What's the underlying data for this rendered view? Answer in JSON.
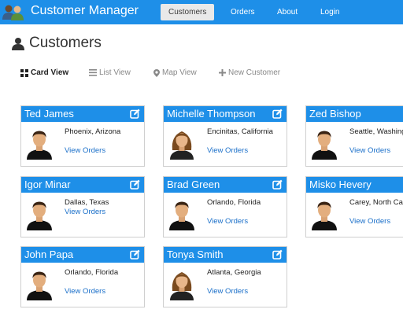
{
  "app": {
    "title": "Customer Manager",
    "accent": "#1e8fe8"
  },
  "nav": {
    "items": [
      {
        "label": "Customers",
        "active": true
      },
      {
        "label": "Orders",
        "active": false
      },
      {
        "label": "About",
        "active": false
      },
      {
        "label": "Login",
        "active": false
      }
    ]
  },
  "page": {
    "title": "Customers",
    "title_icon": "user-icon"
  },
  "toolbar": {
    "items": [
      {
        "label": "Card View",
        "icon": "grid-icon",
        "active": true
      },
      {
        "label": "List View",
        "icon": "list-icon",
        "active": false
      },
      {
        "label": "Map View",
        "icon": "map-marker-icon",
        "active": false
      },
      {
        "label": "New Customer",
        "icon": "plus-icon",
        "active": false
      }
    ]
  },
  "customers": [
    {
      "name": "Ted James",
      "city": "Phoenix, Arizona",
      "link": "View Orders",
      "avatar": "male-avatar-icon"
    },
    {
      "name": "Michelle Thompson",
      "city": "Encinitas, California",
      "link": "View Orders",
      "avatar": "female-avatar-icon"
    },
    {
      "name": "Zed Bishop",
      "city": "Seattle, Washington",
      "link": "View Orders",
      "avatar": "male-avatar-icon"
    },
    {
      "name": "Igor Minar",
      "city": "Dallas, Texas",
      "link": "View Orders",
      "avatar": "male-avatar-icon"
    },
    {
      "name": "Brad Green",
      "city": "Orlando, Florida",
      "link": "View Orders",
      "avatar": "male-avatar-icon"
    },
    {
      "name": "Misko Hevery",
      "city": "Carey, North Carolina",
      "link": "View Orders",
      "avatar": "male-avatar-icon"
    },
    {
      "name": "John Papa",
      "city": "Orlando, Florida",
      "link": "View Orders",
      "avatar": "male-avatar-icon"
    },
    {
      "name": "Tonya Smith",
      "city": "Atlanta, Georgia",
      "link": "View Orders",
      "avatar": "female-avatar-icon"
    }
  ]
}
